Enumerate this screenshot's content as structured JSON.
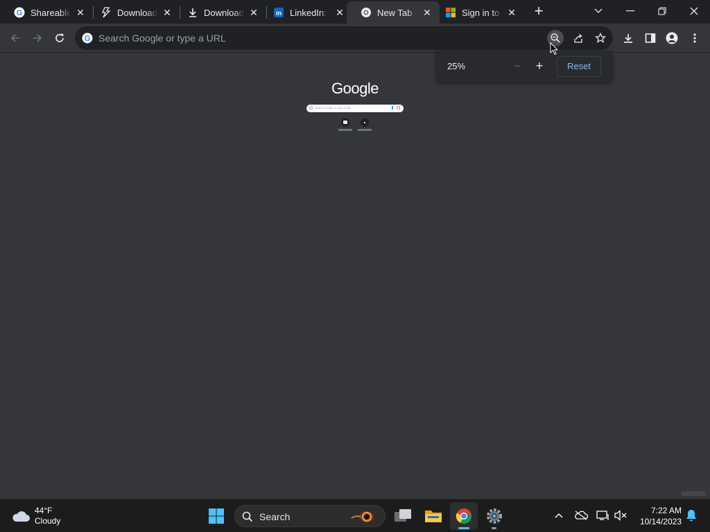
{
  "browser": {
    "tabs": [
      {
        "title": "Shareable",
        "favicon": "google-g-icon"
      },
      {
        "title": "Download",
        "favicon": "bolt-icon"
      },
      {
        "title": "Download",
        "favicon": "download-arrow-icon"
      },
      {
        "title": "LinkedIn: L",
        "favicon": "linkedin-icon"
      },
      {
        "title": "New Tab",
        "favicon": "chrome-icon",
        "active": true
      },
      {
        "title": "Sign in to",
        "favicon": "microsoft-icon"
      }
    ],
    "close_glyph": "✕",
    "new_tab_glyph": "+",
    "omnibox": {
      "placeholder": "Search Google or type a URL"
    },
    "zoom_popup": {
      "percent": "25%",
      "minus": "−",
      "plus": "+",
      "reset_label": "Reset"
    }
  },
  "page": {
    "logo_text": "Google",
    "search_placeholder": "Search Google or type a URL"
  },
  "taskbar": {
    "weather": {
      "temp": "44°F",
      "condition": "Cloudy"
    },
    "search_label": "Search",
    "clock": {
      "time": "7:22 AM",
      "date": "10/14/2023"
    }
  },
  "colors": {
    "tabstrip": "#202124",
    "toolbar": "#35363a",
    "accent_blue": "#8ab4f8",
    "taskbar": "#1c1c1c"
  }
}
